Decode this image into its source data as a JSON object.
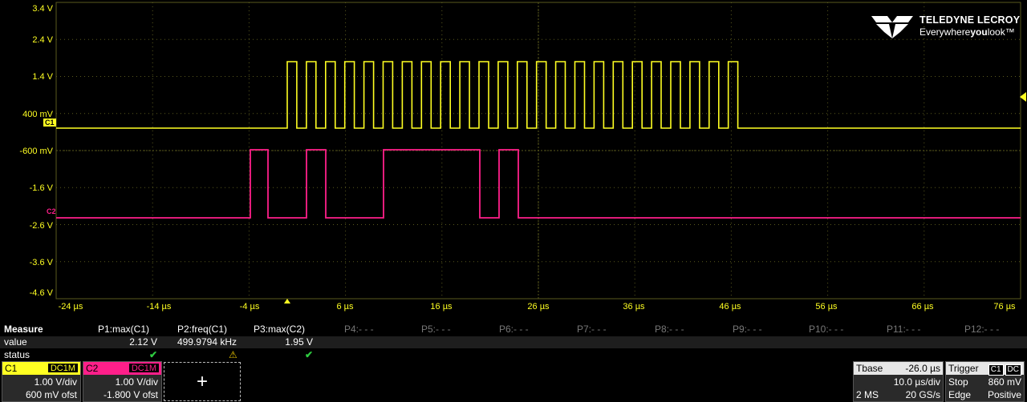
{
  "grid": {
    "y_labels": [
      "3.4 V",
      "2.4 V",
      "1.4 V",
      "400 mV",
      "-600 mV",
      "-1.6 V",
      "-2.6 V",
      "-3.6 V",
      "-4.6 V"
    ],
    "x_labels": [
      "-24 µs",
      "-14 µs",
      "-4 µs",
      "6 µs",
      "16 µs",
      "26 µs",
      "36 µs",
      "46 µs",
      "56 µs",
      "66 µs",
      "76 µs"
    ]
  },
  "logo": {
    "brand": "TELEDYNE LECROY",
    "tag_prefix": "Everywhere",
    "tag_bold": "you",
    "tag_suffix": "look",
    "tm": "™"
  },
  "channels": {
    "c1": {
      "tag": "C1",
      "color": "#ffff22"
    },
    "c2": {
      "tag": "C2",
      "color": "#ff1f8a"
    }
  },
  "measure": {
    "title": "Measure",
    "row_value": "value",
    "row_status": "status",
    "params": [
      {
        "name": "P1:max(C1)",
        "value": "2.12 V",
        "status": "ok"
      },
      {
        "name": "P2:freq(C1)",
        "value": "499.9794 kHz",
        "status": "warn"
      },
      {
        "name": "P3:max(C2)",
        "value": "1.95 V",
        "status": "ok"
      },
      {
        "name": "P4:- - -",
        "value": "",
        "status": ""
      },
      {
        "name": "P5:- - -",
        "value": "",
        "status": ""
      },
      {
        "name": "P6:- - -",
        "value": "",
        "status": ""
      },
      {
        "name": "P7:- - -",
        "value": "",
        "status": ""
      },
      {
        "name": "P8:- - -",
        "value": "",
        "status": ""
      },
      {
        "name": "P9:- - -",
        "value": "",
        "status": ""
      },
      {
        "name": "P10:- - -",
        "value": "",
        "status": ""
      },
      {
        "name": "P11:- - -",
        "value": "",
        "status": ""
      },
      {
        "name": "P12:- - -",
        "value": "",
        "status": ""
      }
    ],
    "ok_glyph": "✔",
    "warn_glyph": "⚠"
  },
  "c1_desc": {
    "label": "C1",
    "coupling": "DC1M",
    "vdiv": "1.00 V/div",
    "offset": "600 mV ofst"
  },
  "c2_desc": {
    "label": "C2",
    "coupling": "DC1M",
    "vdiv": "1.00 V/div",
    "offset": "-1.800 V ofst"
  },
  "add_box": {
    "glyph": "+"
  },
  "timebase": {
    "title": "Tbase",
    "delay": "-26.0 µs",
    "tdiv": "10.0 µs/div",
    "mem": "2 MS",
    "rate": "20 GS/s"
  },
  "trigger": {
    "title": "Trigger",
    "src": "C1",
    "cpl": "DC",
    "mode": "Stop",
    "level": "860 mV",
    "type": "Edge",
    "slope": "Positive"
  }
}
